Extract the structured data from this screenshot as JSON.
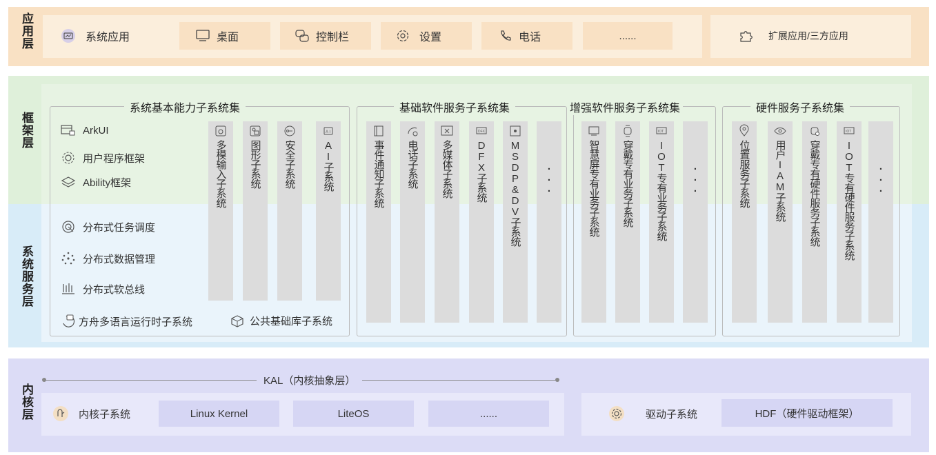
{
  "app_layer": {
    "title": "应用层",
    "items": [
      {
        "label": "系统应用",
        "icon": "system-app-icon"
      },
      {
        "label": "桌面",
        "icon": "desktop-monitor-icon"
      },
      {
        "label": "控制栏",
        "icon": "control-bar-icon"
      },
      {
        "label": "设置",
        "icon": "settings-gear-icon"
      },
      {
        "label": "电话",
        "icon": "phone-icon"
      },
      {
        "label": "......",
        "icon": ""
      }
    ],
    "ext_label": "扩展应用/三方应用",
    "ext_icon": "puzzle-icon"
  },
  "framework_layer": {
    "title": "框架层"
  },
  "service_layer": {
    "title": "系统服务层"
  },
  "basic": {
    "title": "系统基本能力子系统集",
    "items": [
      {
        "label": "ArkUI",
        "icon": "arkui-icon"
      },
      {
        "label": "用户程序框架",
        "icon": "user-program-icon"
      },
      {
        "label": "Ability框架",
        "icon": "ability-layers-icon"
      },
      {
        "label": "分布式任务调度",
        "icon": "task-scheduling-icon"
      },
      {
        "label": "分布式数据管理",
        "icon": "data-management-icon"
      },
      {
        "label": "分布式软总线",
        "icon": "soft-bus-icon"
      }
    ],
    "runtime_label": "方舟多语言运行时子系统",
    "common_label": "公共基础库子系统",
    "columns": [
      "多模输入子系统",
      "图形子系统",
      "安全子系统",
      "AI子系统"
    ]
  },
  "software": {
    "title": "基础软件服务子系统集",
    "columns": [
      "事件通知子系统",
      "电话子系统",
      "多媒体子系统",
      "DFX子系统",
      "MSDP&DV子系统",
      "..."
    ]
  },
  "enhanced": {
    "title": "增强软件服务子系统集",
    "columns": [
      "智慧屏专有业务子系统",
      "穿戴专有业务子系统",
      "IOT专有业务子系统",
      "..."
    ]
  },
  "hardware": {
    "title": "硬件服务子系统集",
    "columns": [
      "位置服务子系统",
      "用户IAM子系统",
      "穿戴专有硬件服务子系统",
      "IOT专有硬件服务子系统",
      "..."
    ]
  },
  "kernel_layer": {
    "title": "内核层",
    "kal_label": "KAL（内核抽象层）",
    "kernel_subsystem": "内核子系统",
    "kernel_items": [
      "Linux Kernel",
      "LiteOS",
      "......"
    ],
    "driver_subsystem": "驱动子系统",
    "hdf": "HDF（硬件驱动框架）"
  },
  "colors": {
    "app_bg": "#f9e1c4",
    "framework_bg": "#dff0da",
    "service_bg": "#d8ecf8",
    "kernel_bg": "#dcdcf6",
    "column": "#dcdcdc"
  }
}
